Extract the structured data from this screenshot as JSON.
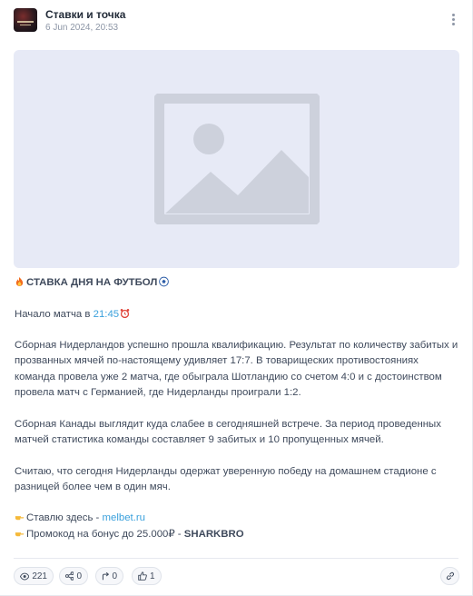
{
  "header": {
    "channel_name": "Ставки и точка",
    "date": "6 Jun 2024, 20:53"
  },
  "post": {
    "headline": "СТАВКА ДНЯ НА ФУТБОЛ",
    "start_prefix": "Начало матча в ",
    "start_time": "21:45",
    "paragraph1": "Сборная Нидерландов успешно прошла квалификацию. Результат по количеству забитых и прозванных мячей по-настоящему удивляет 17:7. В товарищеских противостояниях команда провела уже 2 матча, где обыграла Шотландию со счетом 4:0 и с достоинством провела матч с Германией, где Нидерланды проиграли 1:2.",
    "paragraph2": "Сборная Канады выглядит куда слабее в сегодняшней встрече. За период проведенных матчей статистика команды составляет 9 забитых и 10 пропущенных мячей.",
    "paragraph3": "Считаю, что сегодня Нидерланды одержат уверенную победу на домашнем стадионе с разницей более чем в один мяч.",
    "bet_prefix": "Ставлю здесь - ",
    "bet_link": "melbet.ru",
    "promo_prefix": "Промокод на бонус до 25.000₽ - ",
    "promo_code": "SHARKBRO"
  },
  "stats": {
    "views": "221",
    "shares": "0",
    "forwards": "0",
    "likes": "1"
  },
  "colors": {
    "accent": "#3aa0dc",
    "image_placeholder_bg": "#e7eaf6",
    "image_placeholder_icon": "#cdd1dc"
  },
  "icons": {
    "header": [
      "channel-avatar",
      "more-vertical-icon"
    ],
    "post": [
      "image-placeholder-icon",
      "fire-icon",
      "soccer-ball-icon",
      "alarm-clock-icon",
      "pointing-hand-icon"
    ],
    "footer": [
      "eye-icon",
      "share-nodes-icon",
      "forward-arrow-icon",
      "thumbs-up-icon",
      "link-icon"
    ]
  }
}
